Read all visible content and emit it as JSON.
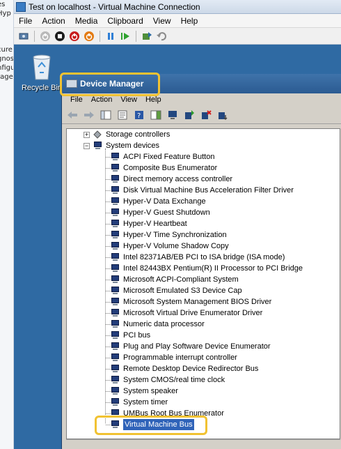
{
  "host_sliver": [
    "es",
    "Hyp",
    "",
    "",
    "",
    "cure",
    "gnos",
    "nfigu",
    "rage"
  ],
  "vm": {
    "title": "Test on localhost - Virtual Machine Connection",
    "menu": [
      "File",
      "Action",
      "Media",
      "Clipboard",
      "View",
      "Help"
    ],
    "toolbar": [
      "ctrl-alt-del-icon",
      "start-icon",
      "turn-off-icon",
      "shut-down-icon",
      "save-icon",
      "pause-icon",
      "reset-icon",
      "snapshot-icon",
      "revert-icon"
    ]
  },
  "desktop": {
    "recycle_bin_label": "Recycle Bin"
  },
  "device_manager": {
    "title": "Device Manager",
    "menu": [
      "File",
      "Action",
      "View",
      "Help"
    ],
    "tree": {
      "storage_controllers": "Storage controllers",
      "system_devices": "System devices",
      "devices": [
        "ACPI Fixed Feature Button",
        "Composite Bus Enumerator",
        "Direct memory access controller",
        "Disk Virtual Machine Bus Acceleration Filter Driver",
        "Hyper-V Data Exchange",
        "Hyper-V Guest Shutdown",
        "Hyper-V Heartbeat",
        "Hyper-V Time Synchronization",
        "Hyper-V Volume Shadow Copy",
        "Intel 82371AB/EB PCI to ISA bridge (ISA mode)",
        "Intel 82443BX Pentium(R) II Processor to PCI Bridge",
        "Microsoft ACPI-Compliant System",
        "Microsoft Emulated S3 Device Cap",
        "Microsoft System Management BIOS Driver",
        "Microsoft Virtual Drive Enumerator Driver",
        "Numeric data processor",
        "PCI bus",
        "Plug and Play Software Device Enumerator",
        "Programmable interrupt controller",
        "Remote Desktop Device Redirector Bus",
        "System CMOS/real time clock",
        "System speaker",
        "System timer",
        "UMBus Root Bus Enumerator"
      ],
      "selected_device": "Virtual Machine Bus"
    }
  },
  "colors": {
    "desktop": "#2f6aa3",
    "highlight": "#f1c232",
    "selection": "#2f63b9"
  }
}
